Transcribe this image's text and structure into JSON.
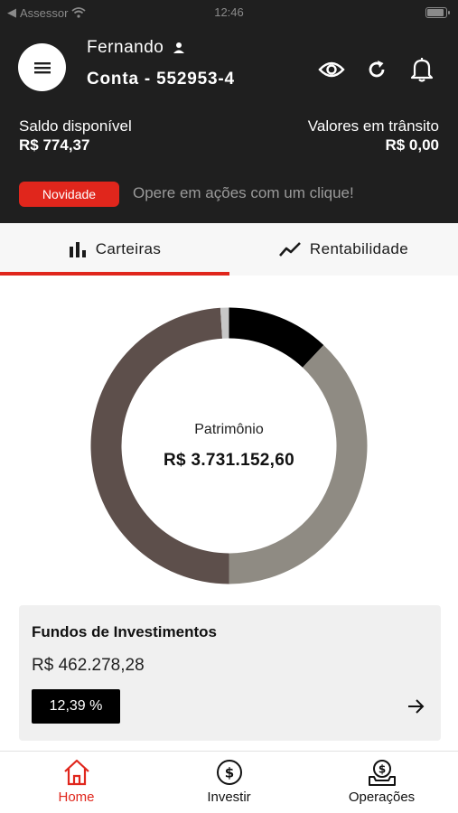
{
  "status_bar": {
    "back_app": "Assessor",
    "time": "12:46"
  },
  "header": {
    "user_name": "Fernando",
    "account": "Conta - 552953-4",
    "saldo_label": "Saldo disponível",
    "saldo_value": "R$ 774,37",
    "transit_label": "Valores em trânsito",
    "transit_value": "R$ 0,00",
    "badge": "Novidade",
    "promo": "Opere em ações com um clique!",
    "icons": [
      "menu-icon",
      "eye-icon",
      "refresh-icon",
      "bell-icon",
      "user-icon"
    ]
  },
  "tabs": [
    {
      "label": "Carteiras",
      "icon": "bar-chart-icon",
      "active": true
    },
    {
      "label": "Rentabilidade",
      "icon": "trend-line-icon",
      "active": false
    }
  ],
  "portfolio": {
    "label": "Patrimônio",
    "total": "R$ 3.731.152,60",
    "segments": [
      {
        "value": 0.12,
        "color": "#000000"
      },
      {
        "value": 0.38,
        "color": "#8f8b83"
      },
      {
        "value": 0.49,
        "color": "#5d4f4b"
      },
      {
        "value": 0.01,
        "color": "#c7c7c7"
      }
    ]
  },
  "card": {
    "title": "Fundos de Investimentos",
    "value": "R$ 462.278,28",
    "percent": "12,39 %"
  },
  "bottom_nav": [
    {
      "label": "Home",
      "icon": "home-icon",
      "active": true
    },
    {
      "label": "Investir",
      "icon": "dollar-circle-icon",
      "active": false
    },
    {
      "label": "Operações",
      "icon": "money-tray-icon",
      "active": false
    }
  ],
  "colors": {
    "accent": "#e0261c",
    "header_bg": "#1f1f1f"
  }
}
